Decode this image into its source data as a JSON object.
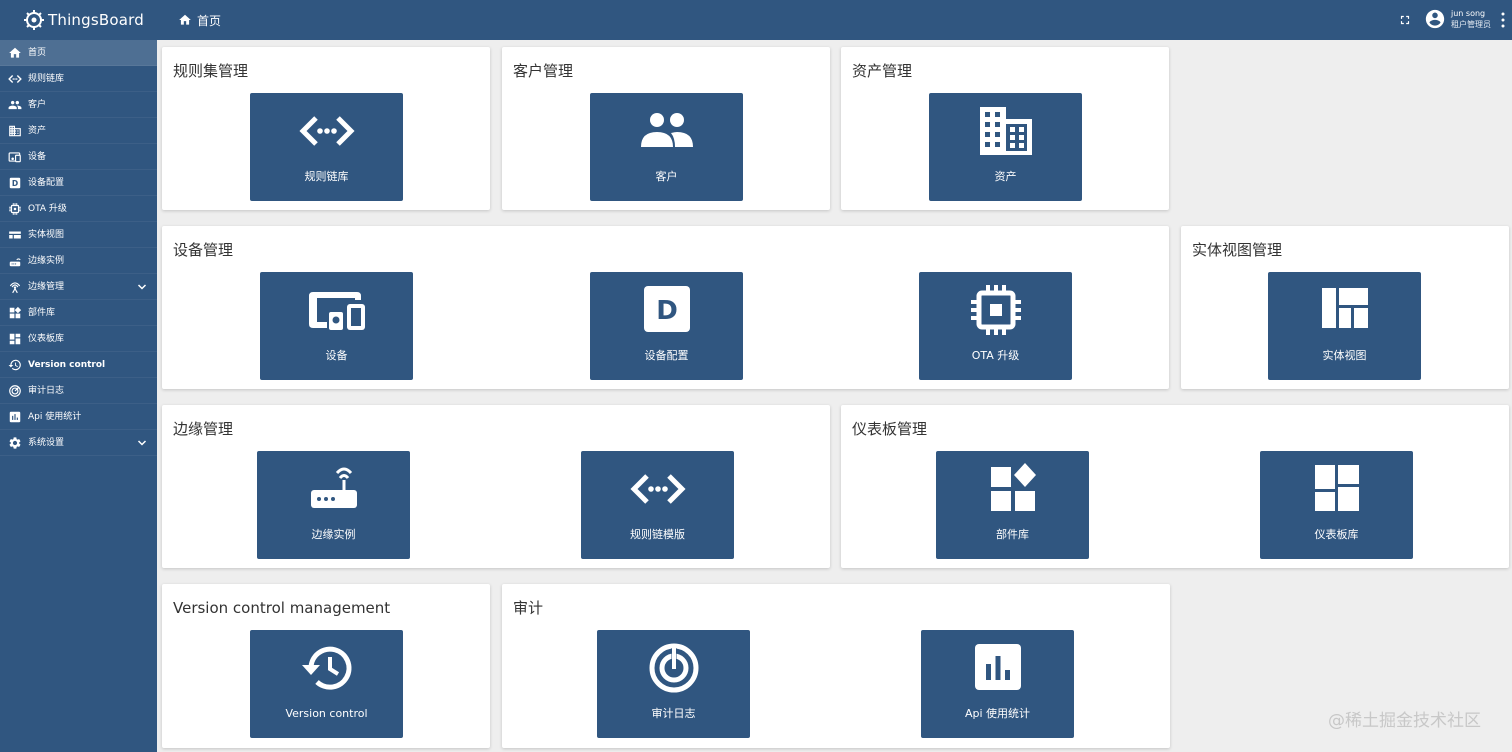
{
  "app": {
    "title": "ThingsBoard",
    "breadcrumb": "首页",
    "user_name": "jun song",
    "user_role": "租户管理员",
    "brand_color": "#305680"
  },
  "sidebar": {
    "items": [
      {
        "label": "首页",
        "icon": "home-icon",
        "active": true
      },
      {
        "label": "规则链库",
        "icon": "code-arrows-icon"
      },
      {
        "label": "客户",
        "icon": "people-icon"
      },
      {
        "label": "资产",
        "icon": "building-icon"
      },
      {
        "label": "设备",
        "icon": "devices-icon"
      },
      {
        "label": "设备配置",
        "icon": "device-profile-icon"
      },
      {
        "label": "OTA 升级",
        "icon": "memory-chip-icon"
      },
      {
        "label": "实体视图",
        "icon": "view-quilt-icon"
      },
      {
        "label": "边缘实例",
        "icon": "router-icon"
      },
      {
        "label": "边缘管理",
        "icon": "settings-input-antenna-icon",
        "expandable": true
      },
      {
        "label": "部件库",
        "icon": "widgets-icon"
      },
      {
        "label": "仪表板库",
        "icon": "dashboard-icon"
      },
      {
        "label": "Version control",
        "icon": "history-icon"
      },
      {
        "label": "审计日志",
        "icon": "track-changes-icon"
      },
      {
        "label": "Api 使用统计",
        "icon": "insert-chart-icon"
      },
      {
        "label": "系统设置",
        "icon": "gear-icon",
        "expandable": true
      }
    ]
  },
  "cards": {
    "rulechain": {
      "title": "规则集管理",
      "tiles": [
        {
          "label": "规则链库",
          "icon": "code-arrows-icon"
        }
      ]
    },
    "customers": {
      "title": "客户管理",
      "tiles": [
        {
          "label": "客户",
          "icon": "people-icon"
        }
      ]
    },
    "assets": {
      "title": "资产管理",
      "tiles": [
        {
          "label": "资产",
          "icon": "building-icon"
        }
      ]
    },
    "devices": {
      "title": "设备管理",
      "tiles": [
        {
          "label": "设备",
          "icon": "devices-icon"
        },
        {
          "label": "设备配置",
          "icon": "device-profile-icon"
        },
        {
          "label": "OTA 升级",
          "icon": "memory-chip-icon"
        }
      ]
    },
    "entityviews": {
      "title": "实体视图管理",
      "tiles": [
        {
          "label": "实体视图",
          "icon": "view-quilt-icon"
        }
      ]
    },
    "edge": {
      "title": "边缘管理",
      "tiles": [
        {
          "label": "边缘实例",
          "icon": "router-icon"
        },
        {
          "label": "规则链模版",
          "icon": "code-arrows-icon"
        }
      ]
    },
    "dashboards": {
      "title": "仪表板管理",
      "tiles": [
        {
          "label": "部件库",
          "icon": "widgets-icon"
        },
        {
          "label": "仪表板库",
          "icon": "dashboard-icon"
        }
      ]
    },
    "versioncontrol": {
      "title": "Version control management",
      "tiles": [
        {
          "label": "Version control",
          "icon": "history-icon"
        }
      ]
    },
    "audit": {
      "title": "审计",
      "tiles": [
        {
          "label": "审计日志",
          "icon": "track-changes-icon"
        },
        {
          "label": "Api 使用统计",
          "icon": "insert-chart-icon"
        }
      ]
    }
  },
  "watermark": "@稀土掘金技术社区"
}
